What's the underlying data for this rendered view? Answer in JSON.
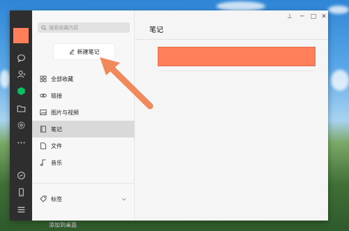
{
  "desktop": {
    "label": "添加到桌面"
  },
  "sidebar": {
    "search_placeholder": "搜索收藏内容",
    "new_note_label": "新建笔记",
    "items": [
      {
        "label": "全部收藏",
        "icon": "grid-icon"
      },
      {
        "label": "链接",
        "icon": "link-icon"
      },
      {
        "label": "图片与视频",
        "icon": "image-icon"
      },
      {
        "label": "笔记",
        "icon": "note-icon",
        "selected": true
      },
      {
        "label": "文件",
        "icon": "file-icon"
      },
      {
        "label": "音乐",
        "icon": "music-icon"
      }
    ],
    "tags_label": "标签"
  },
  "main": {
    "title": "笔记",
    "titlebar": {
      "pin": "⊥",
      "minimize": "─",
      "maximize": "□",
      "close": "✕"
    }
  },
  "colors": {
    "accent": "#ff7f5a",
    "rail": "#2e2e2e",
    "active_icon": "#07c160"
  }
}
